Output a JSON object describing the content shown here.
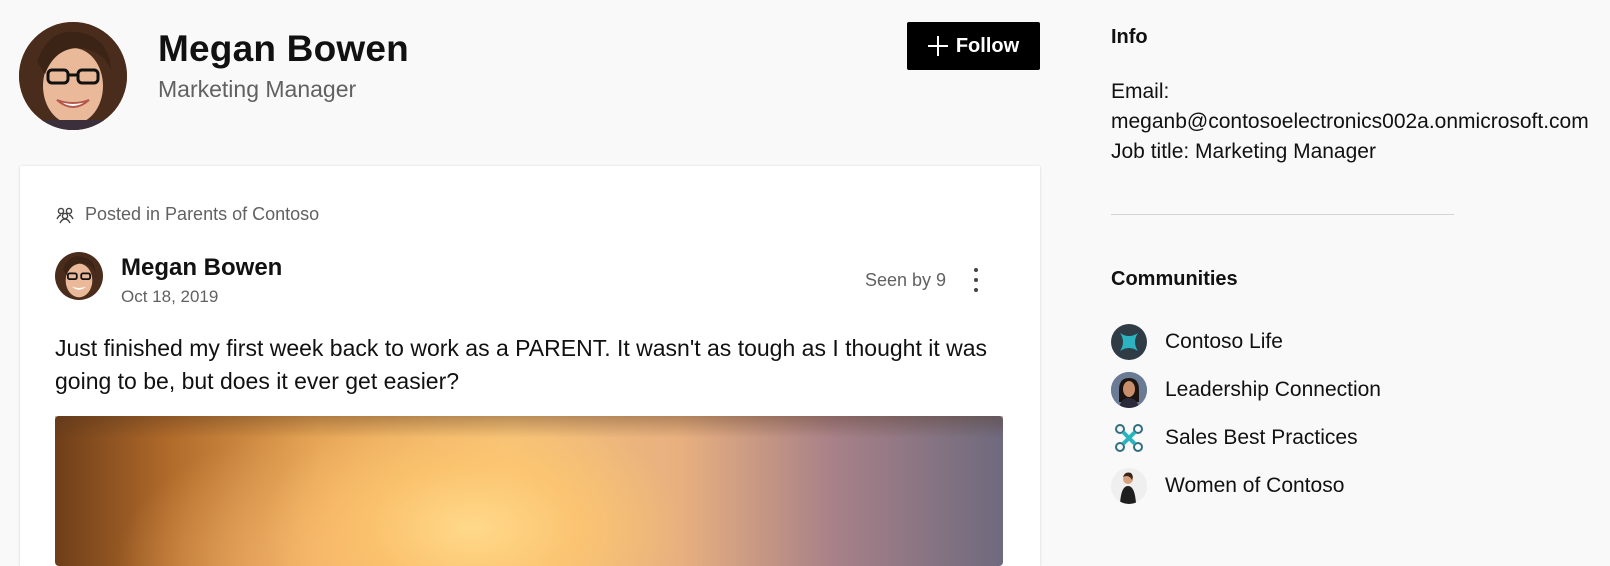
{
  "profile": {
    "name": "Megan Bowen",
    "title": "Marketing Manager",
    "avatar_icon": "person-photo",
    "follow_label": "Follow"
  },
  "post": {
    "posted_in": "Posted in Parents of Contoso",
    "author": "Megan Bowen",
    "date": "Oct 18, 2019",
    "seen_by": "Seen by 9",
    "body": "Just finished my first week back to work as a PARENT. It wasn't as tough as I thought it was going to be, but does it ever get easier?"
  },
  "info": {
    "heading": "Info",
    "email_label": "Email:",
    "email": "meganb@contosoelectronics002a.onmicrosoft.com",
    "job_title": "Job title: Marketing Manager"
  },
  "communities": {
    "heading": "Communities",
    "items": [
      {
        "label": "Contoso Life",
        "icon": "contoso-life-icon"
      },
      {
        "label": "Leadership Connection",
        "icon": "leadership-icon"
      },
      {
        "label": "Sales Best Practices",
        "icon": "sales-icon"
      },
      {
        "label": "Women of Contoso",
        "icon": "women-icon"
      }
    ]
  },
  "colors": {
    "background": "#f9f9f9",
    "button": "#000000",
    "muted_text": "#616161",
    "accent_teal": "#2bb3c0"
  }
}
